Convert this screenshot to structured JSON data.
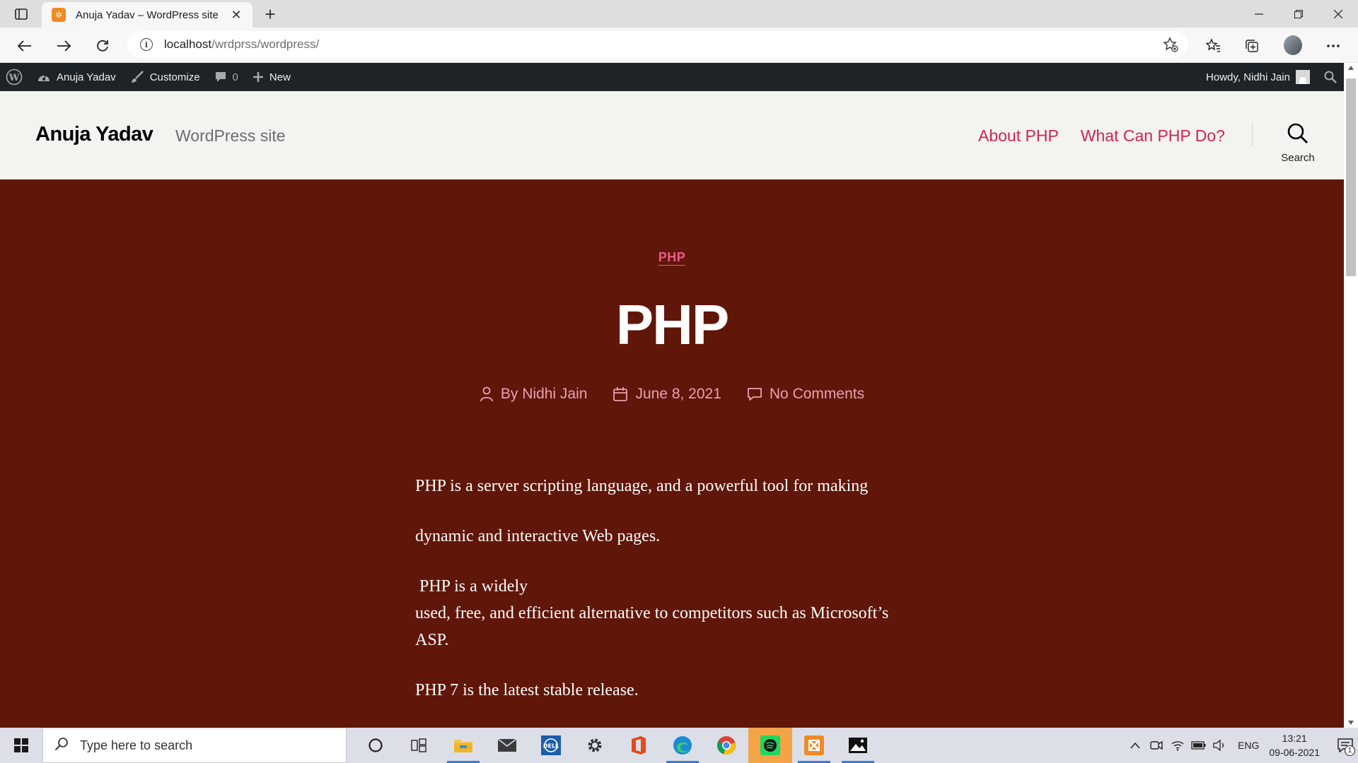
{
  "browser": {
    "tab_title": "Anuja Yadav – WordPress site",
    "url_host": "localhost",
    "url_path": "/wrdprss/wordpress/"
  },
  "admin_bar": {
    "site_name": "Anuja Yadav",
    "customize": "Customize",
    "comments_count": "0",
    "new": "New",
    "howdy": "Howdy, Nidhi Jain"
  },
  "header": {
    "site_title": "Anuja Yadav",
    "tagline": "WordPress site",
    "nav": [
      "About PHP",
      "What Can PHP Do?"
    ],
    "search_label": "Search"
  },
  "post": {
    "category": "PHP",
    "title": "PHP",
    "author": "By Nidhi Jain",
    "date": "June 8, 2021",
    "comments": "No Comments",
    "paragraphs": [
      "PHP is a server scripting language, and a powerful tool for making",
      "dynamic and interactive Web pages.",
      " PHP is a widely",
      "used, free, and efficient alternative to competitors such as Microsoft’s ASP.",
      "PHP 7 is the latest stable release."
    ]
  },
  "taskbar": {
    "search_placeholder": "Type here to search",
    "language": "ENG",
    "time": "13:21",
    "date": "09-06-2021",
    "notification_count": "1"
  },
  "colors": {
    "hero_bg": "#601608",
    "accent": "#cd2653",
    "meta": "#e8a1b3",
    "admin_bar": "#1d2327"
  }
}
